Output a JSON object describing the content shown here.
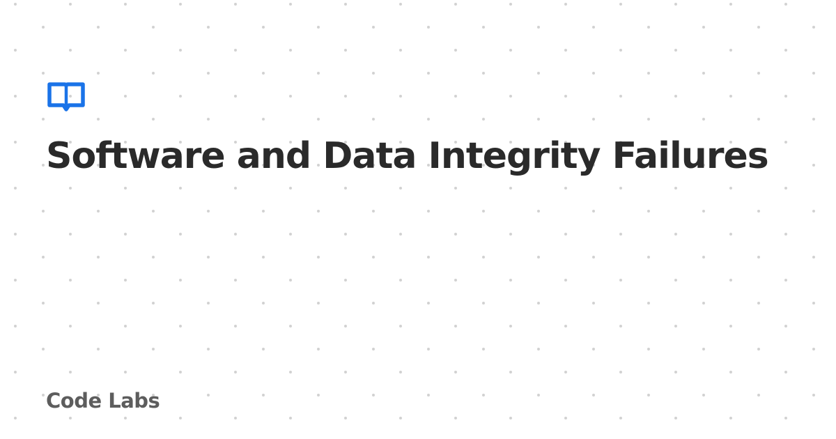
{
  "card": {
    "title": "Software and Data Integrity Failures",
    "brand": "Code Labs",
    "logo_icon": "open-book-icon"
  },
  "colors": {
    "background": "#ffffff",
    "title_text": "#2a2a2a",
    "brand_text": "#5d5d5d",
    "accent": "#1a73e8",
    "dots": "#d2d2d2"
  }
}
